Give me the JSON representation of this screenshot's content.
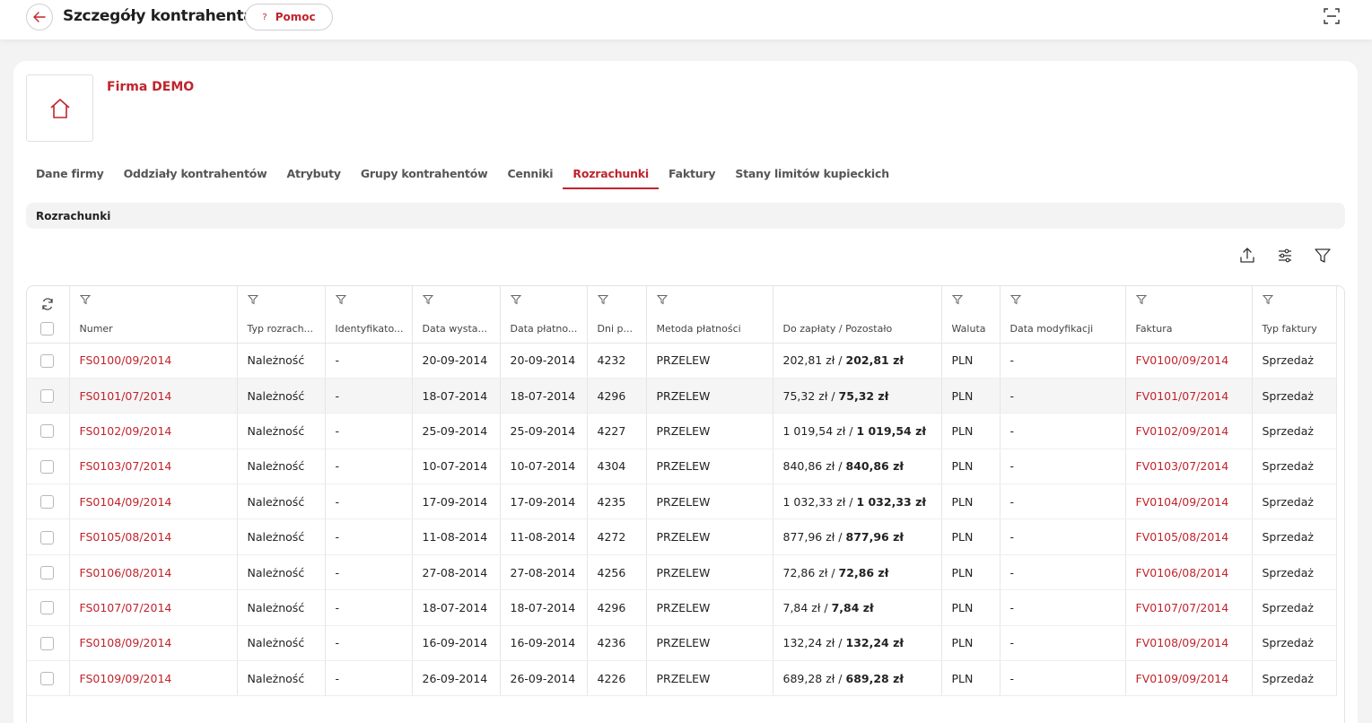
{
  "header": {
    "title": "Szczegóły kontrahenta",
    "help_label": "Pomoc",
    "help_icon": "?"
  },
  "company": {
    "name": "Firma DEMO",
    "logo_icon": "home-icon"
  },
  "tabs": [
    {
      "label": "Dane firmy",
      "active": false
    },
    {
      "label": "Oddziały kontrahentów",
      "active": false
    },
    {
      "label": "Atrybuty",
      "active": false
    },
    {
      "label": "Grupy kontrahentów",
      "active": false
    },
    {
      "label": "Cenniki",
      "active": false
    },
    {
      "label": "Rozrachunki",
      "active": true
    },
    {
      "label": "Faktury",
      "active": false
    },
    {
      "label": "Stany limitów kupieckich",
      "active": false
    }
  ],
  "section": {
    "title": "Rozrachunki"
  },
  "toolbar": {
    "icons": [
      "export-icon",
      "settings-sliders-icon",
      "filter-icon"
    ]
  },
  "table": {
    "columns": [
      {
        "label": "Numer"
      },
      {
        "label": "Typ rozrach..."
      },
      {
        "label": "Identyfikato..."
      },
      {
        "label": "Data wysta..."
      },
      {
        "label": "Data płatno..."
      },
      {
        "label": "Dni p..."
      },
      {
        "label": "Metoda płatności"
      },
      {
        "label": "Do zapłaty / Pozostało"
      },
      {
        "label": "Waluta"
      },
      {
        "label": "Data modyfikacji"
      },
      {
        "label": "Faktura"
      },
      {
        "label": "Typ faktury"
      }
    ],
    "rows": [
      {
        "numer": "FS0100/09/2014",
        "typ": "Należność",
        "ident": "-",
        "data_wyst": "20-09-2014",
        "data_plat": "20-09-2014",
        "dni": "4232",
        "metoda": "PRZELEW",
        "do_zaplaty": "202,81 zł",
        "pozostalo": "202,81 zł",
        "waluta": "PLN",
        "data_mod": "-",
        "faktura": "FV0100/09/2014",
        "typ_faktury": "Sprzedaż"
      },
      {
        "numer": "FS0101/07/2014",
        "typ": "Należność",
        "ident": "-",
        "data_wyst": "18-07-2014",
        "data_plat": "18-07-2014",
        "dni": "4296",
        "metoda": "PRZELEW",
        "do_zaplaty": "75,32 zł",
        "pozostalo": "75,32 zł",
        "waluta": "PLN",
        "data_mod": "-",
        "faktura": "FV0101/07/2014",
        "typ_faktury": "Sprzedaż"
      },
      {
        "numer": "FS0102/09/2014",
        "typ": "Należność",
        "ident": "-",
        "data_wyst": "25-09-2014",
        "data_plat": "25-09-2014",
        "dni": "4227",
        "metoda": "PRZELEW",
        "do_zaplaty": "1 019,54 zł",
        "pozostalo": "1 019,54 zł",
        "waluta": "PLN",
        "data_mod": "-",
        "faktura": "FV0102/09/2014",
        "typ_faktury": "Sprzedaż"
      },
      {
        "numer": "FS0103/07/2014",
        "typ": "Należność",
        "ident": "-",
        "data_wyst": "10-07-2014",
        "data_plat": "10-07-2014",
        "dni": "4304",
        "metoda": "PRZELEW",
        "do_zaplaty": "840,86 zł",
        "pozostalo": "840,86 zł",
        "waluta": "PLN",
        "data_mod": "-",
        "faktura": "FV0103/07/2014",
        "typ_faktury": "Sprzedaż"
      },
      {
        "numer": "FS0104/09/2014",
        "typ": "Należność",
        "ident": "-",
        "data_wyst": "17-09-2014",
        "data_plat": "17-09-2014",
        "dni": "4235",
        "metoda": "PRZELEW",
        "do_zaplaty": "1 032,33 zł",
        "pozostalo": "1 032,33 zł",
        "waluta": "PLN",
        "data_mod": "-",
        "faktura": "FV0104/09/2014",
        "typ_faktury": "Sprzedaż"
      },
      {
        "numer": "FS0105/08/2014",
        "typ": "Należność",
        "ident": "-",
        "data_wyst": "11-08-2014",
        "data_plat": "11-08-2014",
        "dni": "4272",
        "metoda": "PRZELEW",
        "do_zaplaty": "877,96 zł",
        "pozostalo": "877,96 zł",
        "waluta": "PLN",
        "data_mod": "-",
        "faktura": "FV0105/08/2014",
        "typ_faktury": "Sprzedaż"
      },
      {
        "numer": "FS0106/08/2014",
        "typ": "Należność",
        "ident": "-",
        "data_wyst": "27-08-2014",
        "data_plat": "27-08-2014",
        "dni": "4256",
        "metoda": "PRZELEW",
        "do_zaplaty": "72,86 zł",
        "pozostalo": "72,86 zł",
        "waluta": "PLN",
        "data_mod": "-",
        "faktura": "FV0106/08/2014",
        "typ_faktury": "Sprzedaż"
      },
      {
        "numer": "FS0107/07/2014",
        "typ": "Należność",
        "ident": "-",
        "data_wyst": "18-07-2014",
        "data_plat": "18-07-2014",
        "dni": "4296",
        "metoda": "PRZELEW",
        "do_zaplaty": "7,84 zł",
        "pozostalo": "7,84 zł",
        "waluta": "PLN",
        "data_mod": "-",
        "faktura": "FV0107/07/2014",
        "typ_faktury": "Sprzedaż"
      },
      {
        "numer": "FS0108/09/2014",
        "typ": "Należność",
        "ident": "-",
        "data_wyst": "16-09-2014",
        "data_plat": "16-09-2014",
        "dni": "4236",
        "metoda": "PRZELEW",
        "do_zaplaty": "132,24 zł",
        "pozostalo": "132,24 zł",
        "waluta": "PLN",
        "data_mod": "-",
        "faktura": "FV0108/09/2014",
        "typ_faktury": "Sprzedaż"
      },
      {
        "numer": "FS0109/09/2014",
        "typ": "Należność",
        "ident": "-",
        "data_wyst": "26-09-2014",
        "data_plat": "26-09-2014",
        "dni": "4226",
        "metoda": "PRZELEW",
        "do_zaplaty": "689,28 zł",
        "pozostalo": "689,28 zł",
        "waluta": "PLN",
        "data_mod": "-",
        "faktura": "FV0109/09/2014",
        "typ_faktury": "Sprzedaż"
      }
    ]
  },
  "colors": {
    "accent": "#c0242c",
    "background": "#f3f3f4",
    "card": "#ffffff",
    "row_hover": "#f5f5f6"
  }
}
